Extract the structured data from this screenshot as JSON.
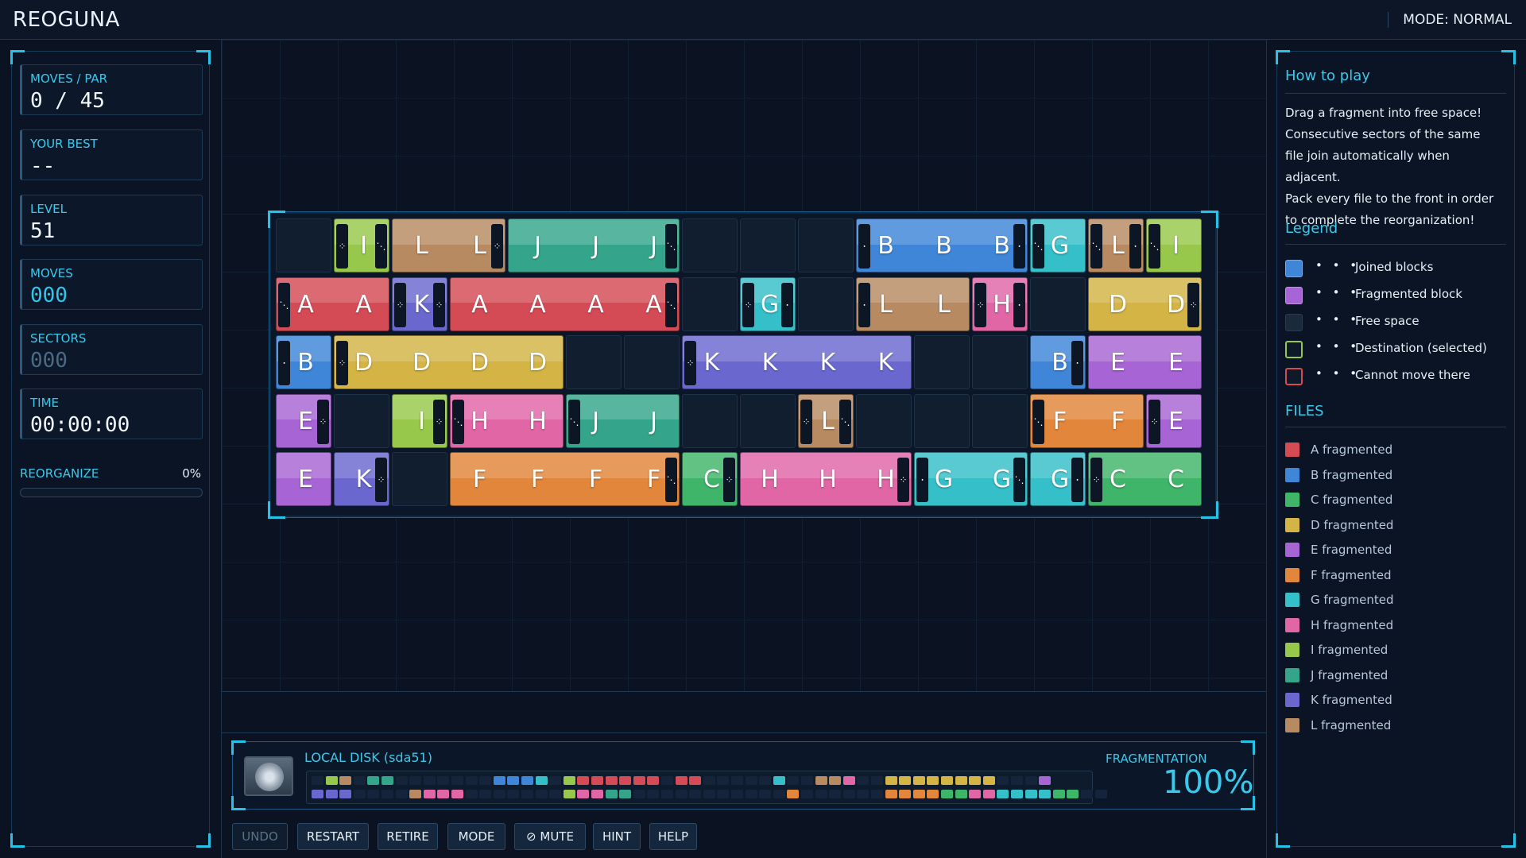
{
  "header": {
    "title": "REOGUNA",
    "mode": "MODE: NORMAL"
  },
  "stats": {
    "moves_par_label": "MOVES / PAR",
    "moves_par_value": "0 / 45",
    "best_label": "YOUR BEST",
    "best_value": "--",
    "level_label": "LEVEL",
    "level_value": "51",
    "moves_label": "MOVES",
    "moves_value": "000",
    "sectors_label": "SECTORS",
    "sectors_value": "000",
    "time_label": "TIME",
    "time_value": "00:00:00"
  },
  "reorganize": {
    "label": "REORGANIZE",
    "percent_text": "0%",
    "progress": 0
  },
  "colors": {
    "A": "#d44a55",
    "B": "#3f86d8",
    "C": "#3fb56a",
    "D": "#d4b444",
    "E": "#a664d4",
    "F": "#e1863a",
    "G": "#35bfc9",
    "H": "#e066a6",
    "I": "#98c84b",
    "J": "#34a58a",
    "K": "#6a68cf",
    "L": "#b88a62"
  },
  "board": {
    "rows": [
      [
        {
          "type": "free",
          "span": 1
        },
        {
          "type": "block",
          "file": "I",
          "letters": [
            "I"
          ],
          "conn_l": "⁘",
          "conn_r": "⋱"
        },
        {
          "type": "block",
          "file": "L",
          "letters": [
            "L",
            "L"
          ],
          "conn_r": "⁘"
        },
        {
          "type": "block",
          "file": "J",
          "letters": [
            "J",
            "J",
            "J"
          ],
          "conn_r": "⋱"
        },
        {
          "type": "free",
          "span": 1
        },
        {
          "type": "free",
          "span": 1
        },
        {
          "type": "free",
          "span": 1
        },
        {
          "type": "block",
          "file": "B",
          "letters": [
            "B",
            "B",
            "B"
          ],
          "conn_l": "⋅",
          "conn_r": "⋅"
        },
        {
          "type": "block",
          "file": "G",
          "letters": [
            "G"
          ],
          "conn_l": "⋱"
        },
        {
          "type": "block",
          "file": "L",
          "letters": [
            "L"
          ],
          "conn_l": "⋱",
          "conn_r": "⋅"
        },
        {
          "type": "block",
          "file": "I",
          "letters": [
            "I"
          ],
          "conn_l": "⋱"
        }
      ],
      [
        {
          "type": "block",
          "file": "A",
          "letters": [
            "A",
            "A"
          ],
          "conn_l": "⋱"
        },
        {
          "type": "block",
          "file": "K",
          "letters": [
            "K"
          ],
          "conn_l": "⁘",
          "conn_r": "⁘"
        },
        {
          "type": "block",
          "file": "A",
          "letters": [
            "A",
            "A",
            "A",
            "A"
          ],
          "conn_r": "⋱"
        },
        {
          "type": "free",
          "span": 1
        },
        {
          "type": "block",
          "file": "G",
          "letters": [
            "G"
          ],
          "conn_l": "⁘",
          "conn_r": "⋅"
        },
        {
          "type": "free",
          "span": 1
        },
        {
          "type": "block",
          "file": "L",
          "letters": [
            "L",
            "L"
          ],
          "conn_l": "⋅"
        },
        {
          "type": "block",
          "file": "H",
          "letters": [
            "H"
          ],
          "conn_l": "⁘",
          "conn_r": "⋅"
        },
        {
          "type": "free",
          "span": 1
        },
        {
          "type": "block",
          "file": "D",
          "letters": [
            "D",
            "D"
          ],
          "conn_r": "⁘"
        }
      ],
      [
        {
          "type": "block",
          "file": "B",
          "letters": [
            "B"
          ],
          "conn_l": "⋅"
        },
        {
          "type": "block",
          "file": "D",
          "letters": [
            "D",
            "D",
            "D",
            "D"
          ],
          "conn_l": "⁘"
        },
        {
          "type": "free",
          "span": 1
        },
        {
          "type": "free",
          "span": 1
        },
        {
          "type": "block",
          "file": "K",
          "letters": [
            "K",
            "K",
            "K",
            "K"
          ],
          "conn_l": "⁘"
        },
        {
          "type": "free",
          "span": 1
        },
        {
          "type": "free",
          "span": 1
        },
        {
          "type": "block",
          "file": "B",
          "letters": [
            "B"
          ],
          "conn_r": "⋅"
        },
        {
          "type": "block",
          "file": "E",
          "letters": [
            "E",
            "E"
          ]
        }
      ],
      [
        {
          "type": "block",
          "file": "E",
          "letters": [
            "E"
          ],
          "conn_r": "⁘"
        },
        {
          "type": "free",
          "span": 1
        },
        {
          "type": "block",
          "file": "I",
          "letters": [
            "I"
          ],
          "conn_r": "⁘"
        },
        {
          "type": "block",
          "file": "H",
          "letters": [
            "H",
            "H"
          ],
          "conn_l": "⋱"
        },
        {
          "type": "block",
          "file": "J",
          "letters": [
            "J",
            "J"
          ],
          "conn_l": "⋱"
        },
        {
          "type": "free",
          "span": 1
        },
        {
          "type": "free",
          "span": 1
        },
        {
          "type": "block",
          "file": "L",
          "letters": [
            "L"
          ],
          "conn_l": "⁘",
          "conn_r": "⋱"
        },
        {
          "type": "free",
          "span": 1
        },
        {
          "type": "free",
          "span": 1
        },
        {
          "type": "free",
          "span": 1
        },
        {
          "type": "block",
          "file": "F",
          "letters": [
            "F",
            "F"
          ],
          "conn_l": "⋱"
        },
        {
          "type": "block",
          "file": "E",
          "letters": [
            "E"
          ],
          "conn_l": "⁘"
        }
      ],
      [
        {
          "type": "block",
          "file": "E",
          "letters": [
            "E"
          ]
        },
        {
          "type": "block",
          "file": "K",
          "letters": [
            "K"
          ],
          "conn_r": "⁘"
        },
        {
          "type": "free",
          "span": 1
        },
        {
          "type": "block",
          "file": "F",
          "letters": [
            "F",
            "F",
            "F",
            "F"
          ],
          "conn_r": "⋱"
        },
        {
          "type": "block",
          "file": "C",
          "letters": [
            "C"
          ],
          "conn_r": "⁘"
        },
        {
          "type": "block",
          "file": "H",
          "letters": [
            "H",
            "H",
            "H"
          ],
          "conn_r": "⁘"
        },
        {
          "type": "block",
          "file": "G",
          "letters": [
            "G",
            "G"
          ],
          "conn_l": "⋅",
          "conn_r": "⋱"
        },
        {
          "type": "block",
          "file": "G",
          "letters": [
            "G"
          ],
          "conn_r": "⋅"
        },
        {
          "type": "block",
          "file": "C",
          "letters": [
            "C",
            "C"
          ],
          "conn_l": "⁘"
        }
      ]
    ]
  },
  "disk": {
    "name": "LOCAL DISK (sda51)",
    "frag_label": "FRAGMENTATION",
    "frag_value": "100%",
    "map_row1": "_IL_JJ_______BBBG_IAAAAAA_AA_____G__LLH__DDDDDDDD___E",
    "map_row2": "KKK____LHHH_______IHHJJ___________F______FFFFCCHHGGGGCC__"
  },
  "buttons": [
    {
      "id": "undo",
      "label": "UNDO",
      "disabled": true
    },
    {
      "id": "restart",
      "label": "RESTART"
    },
    {
      "id": "retire",
      "label": "RETIRE"
    },
    {
      "id": "mode",
      "label": "MODE"
    },
    {
      "id": "mute",
      "label": "MUTE",
      "icon": "mute-icon"
    },
    {
      "id": "hint",
      "label": "HINT"
    },
    {
      "id": "help",
      "label": "HELP"
    }
  ],
  "help": {
    "title": "How to play",
    "lines": [
      "Drag a fragment into free space!",
      "Consecutive sectors of the same",
      "file join automatically when adjacent.",
      "Pack every file to the front in order",
      "to complete the reorganization!"
    ],
    "legend_title": "Legend",
    "legend": [
      {
        "text": "Joined blocks",
        "color": "#3f86d8",
        "style": "solid"
      },
      {
        "text": "Fragmented block",
        "color": "#a664d4",
        "style": "solid"
      },
      {
        "text": "Free space",
        "color": "#1a2a3c",
        "style": "free"
      },
      {
        "text": "Destination (selected)",
        "color": "#98c84b",
        "style": "outline"
      },
      {
        "text": "Cannot move there",
        "color": "#d44a55",
        "style": "outline"
      }
    ],
    "legend_dots": "• • •",
    "files_title": "FILES",
    "files": [
      {
        "text": "A  fragmented",
        "file": "A"
      },
      {
        "text": "B  fragmented",
        "file": "B"
      },
      {
        "text": "C  fragmented",
        "file": "C"
      },
      {
        "text": "D  fragmented",
        "file": "D"
      },
      {
        "text": "E  fragmented",
        "file": "E"
      },
      {
        "text": "F  fragmented",
        "file": "F"
      },
      {
        "text": "G  fragmented",
        "file": "G"
      },
      {
        "text": "H  fragmented",
        "file": "H"
      },
      {
        "text": "I  fragmented",
        "file": "I"
      },
      {
        "text": "J  fragmented",
        "file": "J"
      },
      {
        "text": "K  fragmented",
        "file": "K"
      },
      {
        "text": "L  fragmented",
        "file": "L"
      }
    ]
  }
}
